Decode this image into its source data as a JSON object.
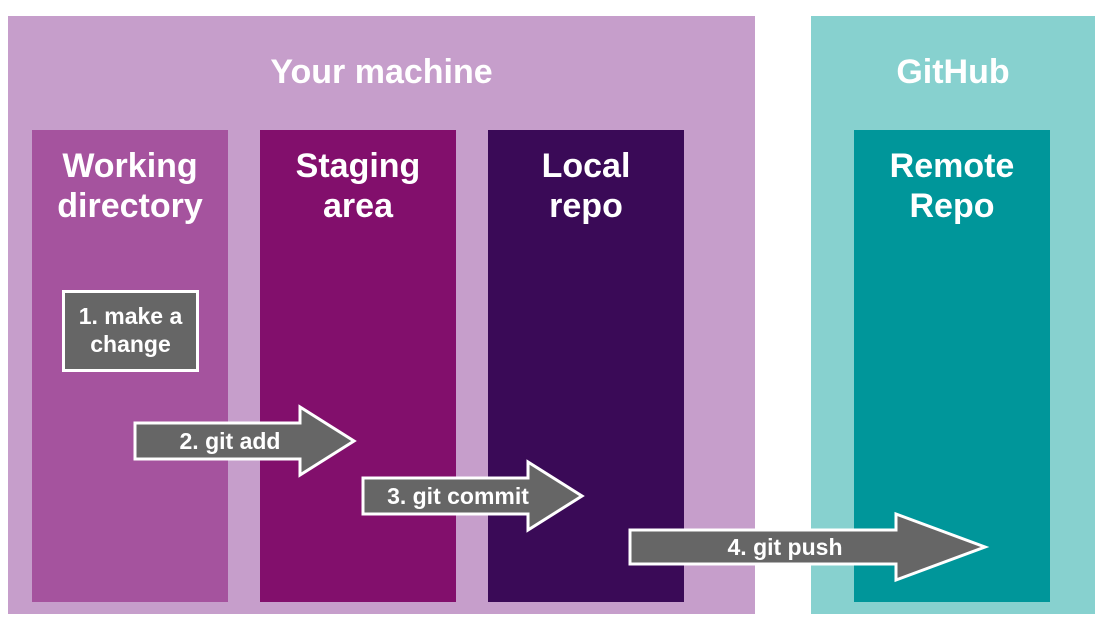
{
  "machine": {
    "title": "Your machine",
    "columns": [
      {
        "title": "Working\ndirectory",
        "color": "#a5539e"
      },
      {
        "title": "Staging\narea",
        "color": "#820f6c"
      },
      {
        "title": "Local\nrepo",
        "color": "#3a0a57"
      }
    ],
    "color": "#c69ecb"
  },
  "github": {
    "title": "GitHub",
    "column": {
      "title": "Remote\nRepo",
      "color": "#00969a"
    },
    "color": "#87d1cf"
  },
  "steps": [
    {
      "label": "1. make a\nchange",
      "kind": "box"
    },
    {
      "label": "2. git add",
      "kind": "arrow"
    },
    {
      "label": "3. git commit",
      "kind": "arrow"
    },
    {
      "label": "4. git push",
      "kind": "arrow"
    }
  ],
  "colors": {
    "step_fill": "#666666",
    "step_stroke": "#ffffff",
    "text": "#ffffff"
  }
}
